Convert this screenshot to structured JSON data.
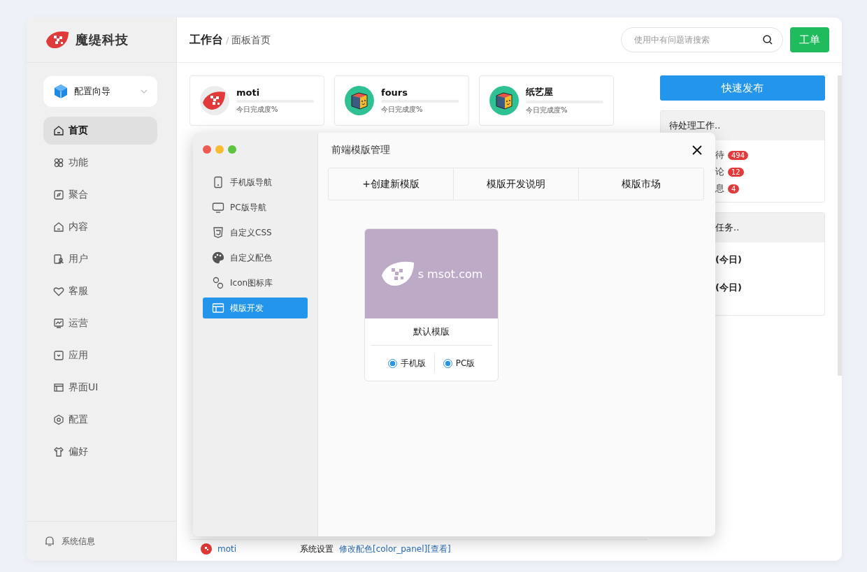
{
  "brand": {
    "name": "魔缇科技"
  },
  "guide": {
    "label": "配置向导"
  },
  "nav": [
    {
      "label": "首页",
      "selected": true
    },
    {
      "label": "功能",
      "selected": false
    },
    {
      "label": "聚合",
      "selected": false
    },
    {
      "label": "内容",
      "selected": false
    },
    {
      "label": "用户",
      "selected": false
    },
    {
      "label": "客服",
      "selected": false
    },
    {
      "label": "运营",
      "selected": false
    },
    {
      "label": "应用",
      "selected": false
    },
    {
      "label": "界面UI",
      "selected": false
    },
    {
      "label": "配置",
      "selected": false
    },
    {
      "label": "偏好",
      "selected": false
    }
  ],
  "footer": {
    "label": "系统信息"
  },
  "breadcrumb": {
    "title": "工作台",
    "separator": "/",
    "page": "面板首页"
  },
  "search": {
    "placeholder": "使用中有问题请搜索"
  },
  "ticket_button": "工单",
  "sites": [
    {
      "name": "moti",
      "caption": "今日完成度%",
      "kind": "leaf"
    },
    {
      "name": "fours",
      "caption": "今日完成度%",
      "kind": "cube"
    },
    {
      "name": "纸艺屋",
      "caption": "今日完成度%",
      "kind": "cube"
    }
  ],
  "publish_button": "快速发布",
  "pending": {
    "title": "待处理工作..",
    "items": [
      {
        "label": "待",
        "count": "494"
      },
      {
        "label": "论",
        "count": "12"
      },
      {
        "label": "息",
        "count": "4"
      }
    ]
  },
  "tasks": {
    "title": "任务..",
    "items": [
      "(今日)",
      "(今日)"
    ]
  },
  "log_row": {
    "user": "moti",
    "module": "系统设置",
    "action": "修改配色[color_panel][查看]"
  },
  "modal": {
    "title": "前端模版管理",
    "menu": [
      {
        "label": "手机版导航",
        "selected": false
      },
      {
        "label": "PC版导航",
        "selected": false
      },
      {
        "label": "自定义CSS",
        "selected": false
      },
      {
        "label": "自定义配色",
        "selected": false
      },
      {
        "label": "Icon图标库",
        "selected": false
      },
      {
        "label": "模版开发",
        "selected": true
      }
    ],
    "actions": [
      "+创建新模版",
      "模版开发说明",
      "模版市场"
    ],
    "templates": [
      {
        "name": "默认模版",
        "preview_text": "s msot.com",
        "options": [
          {
            "label": "手机版",
            "checked": true
          },
          {
            "label": "PC版",
            "checked": true
          }
        ]
      }
    ]
  }
}
